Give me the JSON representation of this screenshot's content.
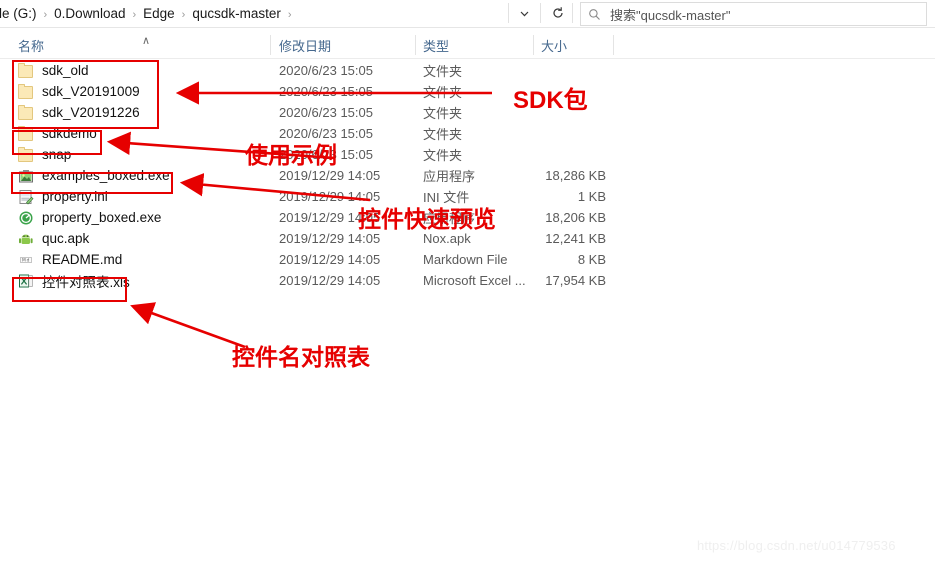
{
  "window": {
    "breadcrumb": [
      {
        "label": "ile (G:)"
      },
      {
        "label": "0.Download"
      },
      {
        "label": "Edge"
      },
      {
        "label": "qucsdk-master"
      }
    ],
    "separator": "›",
    "chevron_icon": "chevron-down-icon",
    "refresh_icon": "refresh-icon",
    "search": {
      "icon": "search-icon",
      "value": "搜索\"qucsdk-master\""
    }
  },
  "columns": [
    {
      "key": "name",
      "label": "名称"
    },
    {
      "key": "date",
      "label": "修改日期"
    },
    {
      "key": "type",
      "label": "类型"
    },
    {
      "key": "size",
      "label": "大小"
    }
  ],
  "sort_caret": "∧",
  "files": [
    {
      "name": "sdk_old",
      "icon": "folder-icon",
      "date": "2020/6/23 15:05",
      "type": "文件夹",
      "size": ""
    },
    {
      "name": "sdk_V20191009",
      "icon": "folder-icon",
      "date": "2020/6/23 15:05",
      "type": "文件夹",
      "size": ""
    },
    {
      "name": "sdk_V20191226",
      "icon": "folder-icon",
      "date": "2020/6/23 15:05",
      "type": "文件夹",
      "size": ""
    },
    {
      "name": "sdkdemo",
      "icon": "folder-icon",
      "date": "2020/6/23 15:05",
      "type": "文件夹",
      "size": ""
    },
    {
      "name": "snap",
      "icon": "folder-icon",
      "date": "2020/6/23 15:05",
      "type": "文件夹",
      "size": ""
    },
    {
      "name": "examples_boxed.exe",
      "icon": "image-app-icon",
      "date": "2019/12/29 14:05",
      "type": "应用程序",
      "size": "18,286 KB"
    },
    {
      "name": "property.ini",
      "icon": "ini-file-icon",
      "date": "2019/12/29 14:05",
      "type": "INI 文件",
      "size": "1 KB"
    },
    {
      "name": "property_boxed.exe",
      "icon": "green-app-icon",
      "date": "2019/12/29 14:05",
      "type": "应用程序",
      "size": "18,206 KB"
    },
    {
      "name": "quc.apk",
      "icon": "android-icon",
      "date": "2019/12/29 14:05",
      "type": "Nox.apk",
      "size": "12,241 KB"
    },
    {
      "name": "README.md",
      "icon": "markdown-icon",
      "date": "2019/12/29 14:05",
      "type": "Markdown File",
      "size": "8 KB"
    },
    {
      "name": "控件对照表.xls",
      "icon": "excel-icon",
      "date": "2019/12/29 14:05",
      "type": "Microsoft Excel ...",
      "size": "17,954 KB"
    }
  ],
  "annotations": {
    "color": "#e60000",
    "labels": [
      {
        "id": "sdk-package",
        "text": "SDK包"
      },
      {
        "id": "usage-example",
        "text": "使用示例"
      },
      {
        "id": "quick-preview",
        "text": "控件快速预览"
      },
      {
        "id": "widget-name-list",
        "text": "控件名对照表"
      }
    ]
  },
  "watermark": "https://blog.csdn.net/u014779536"
}
